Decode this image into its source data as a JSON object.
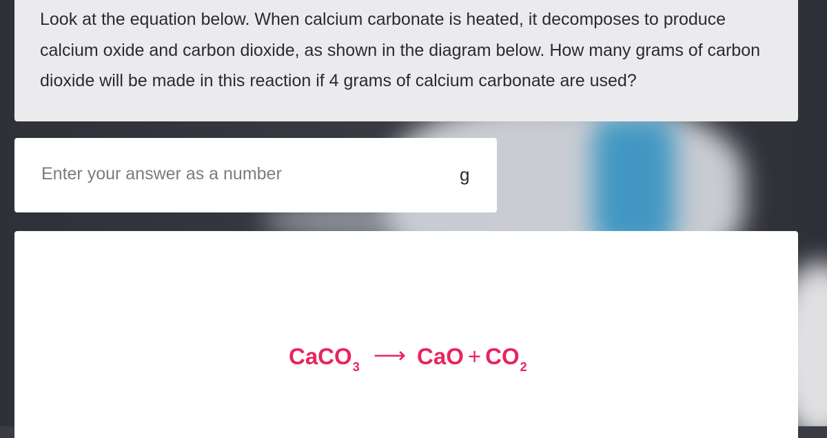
{
  "question": {
    "text": "Look at the equation below. When calcium carbonate is heated, it decomposes to produce calcium oxide and carbon dioxide, as shown in the diagram below. How many grams of carbon dioxide will be made in this reaction if 4 grams of calcium carbonate are used?"
  },
  "answer": {
    "placeholder": "Enter your answer as a number",
    "value": "",
    "unit": "g"
  },
  "equation": {
    "reactant": "CaCO",
    "reactant_subscript": "3",
    "arrow": "⟶",
    "product1": "CaO",
    "plus": "+",
    "product2": "CO",
    "product2_subscript": "2",
    "color": "#e8245f"
  }
}
